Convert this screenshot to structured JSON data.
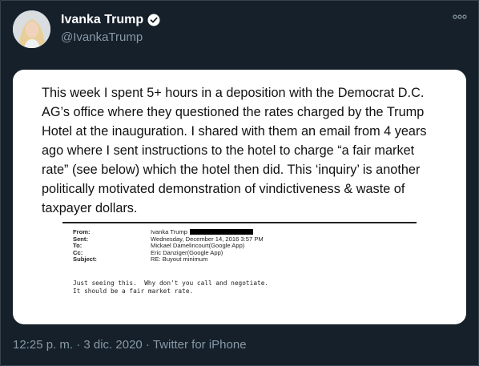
{
  "tweet": {
    "display_name": "Ivanka Trump",
    "handle": "@IvankaTrump",
    "verified_icon": "verified-badge-icon",
    "more_icon": "more-options-icon",
    "timestamp": "12:25 p. m. · 3 dic. 2020 · Twitter for iPhone"
  },
  "image": {
    "statement_lines": [
      "This week I spent 5+ hours in a deposition with the Democrat D.C.",
      "AG’s office where they questioned the rates charged by the Trump",
      "Hotel at the inauguration. I shared with them an email from 4 years",
      "ago where I sent instructions to the hotel to charge “a fair market",
      "rate” (see below) which the hotel then did.  This ‘inquiry’ is another",
      "politically motivated demonstration of vindictiveness & waste of",
      "taxpayer dollars."
    ],
    "email": {
      "fields": [
        {
          "label": "From:",
          "value": "Ivanka Trump"
        },
        {
          "label": "Sent:",
          "value": "Wednesday, December 14, 2016 3:57 PM"
        },
        {
          "label": "To:",
          "value": "Mickael Damelincourt(Google App)"
        },
        {
          "label": "Cc:",
          "value": "Eric Danziger(Google App)"
        },
        {
          "label": "Subject:",
          "value": "RE: Buyout minimum"
        }
      ],
      "body_lines": [
        "Just seeing this.  Why don't you call and negotiate.",
        "It should be a fair market rate."
      ]
    }
  },
  "colors": {
    "background": "#15202b",
    "text_primary": "#ffffff",
    "text_secondary": "#8899a6",
    "verified": "#ffffff"
  }
}
